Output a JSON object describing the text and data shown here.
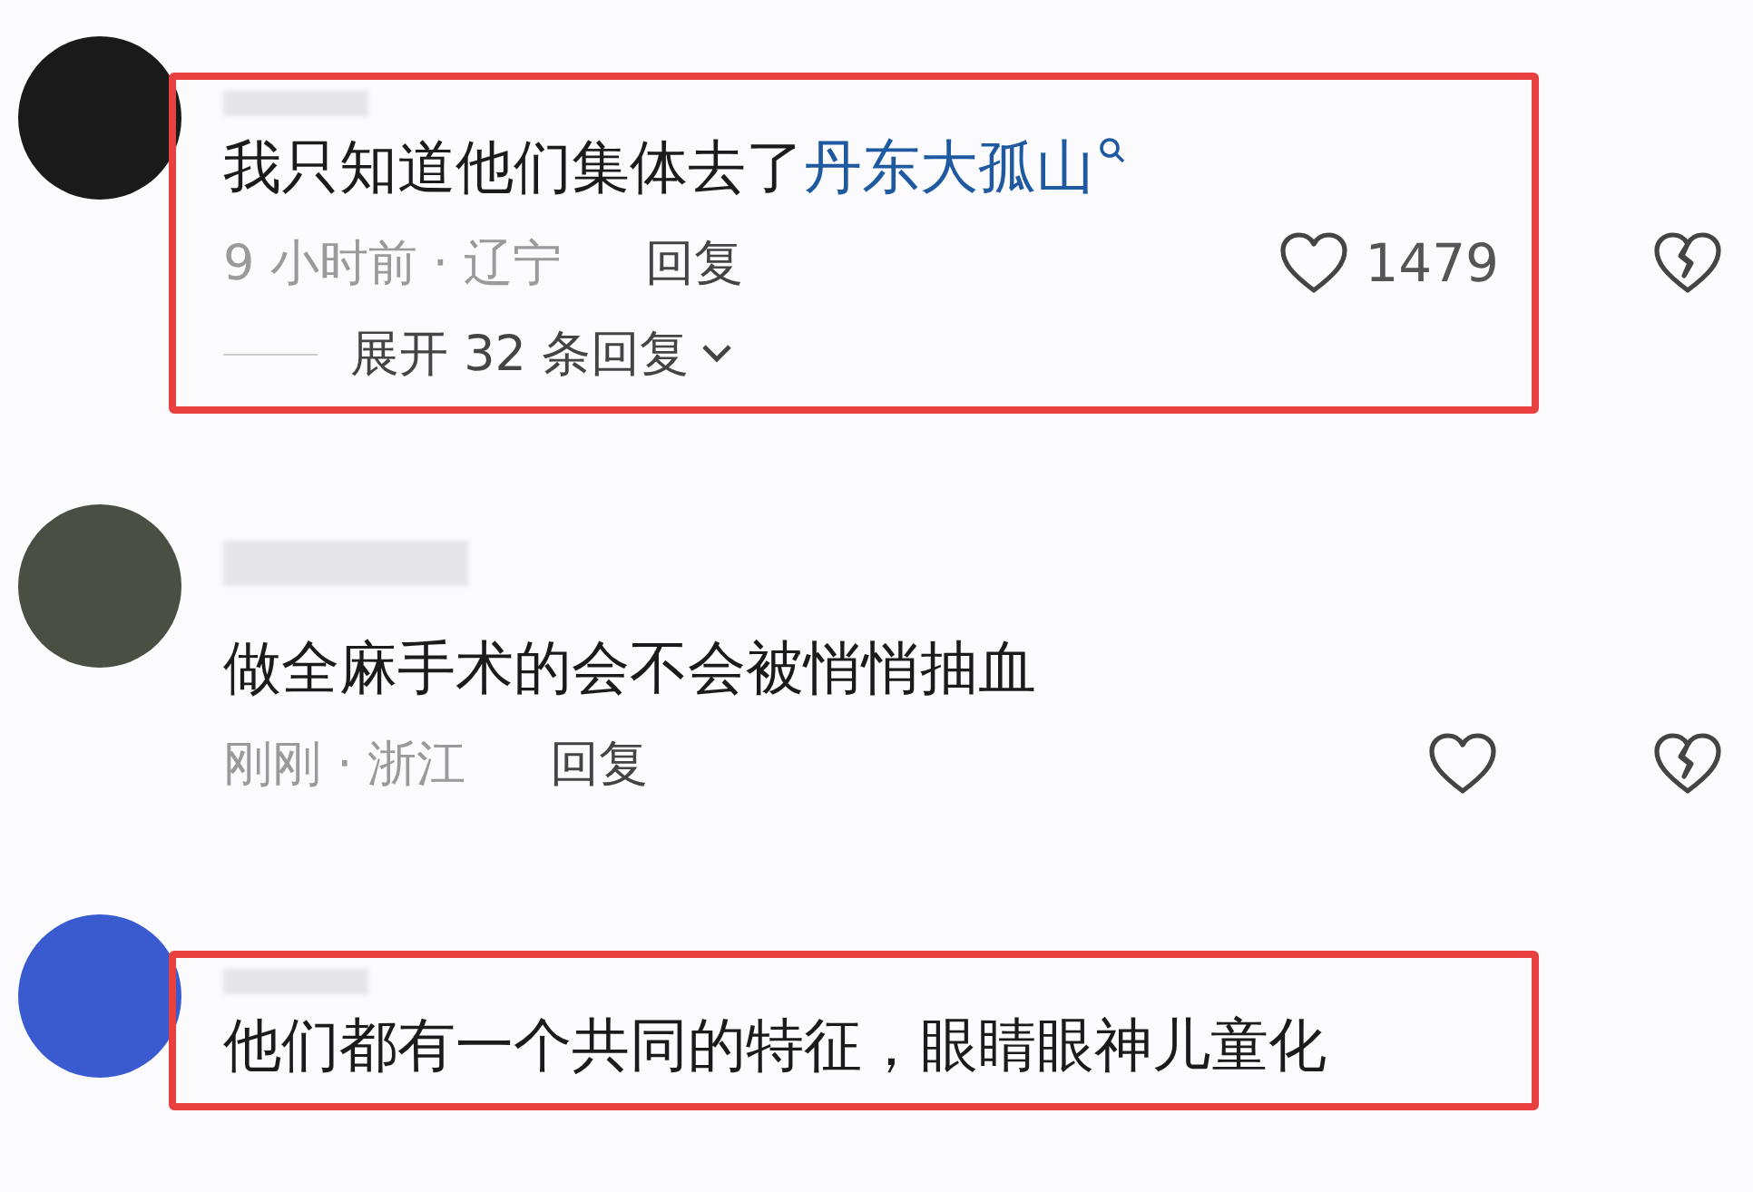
{
  "comments": [
    {
      "highlighted": true,
      "text": "我只知道他们集体去了",
      "link": "丹东大孤山",
      "time_location": "9 小时前 · 辽宁",
      "reply": "回复",
      "likes": "1479",
      "expand": "展开 32 条回复"
    },
    {
      "highlighted": false,
      "text": "做全麻手术的会不会被悄悄抽血",
      "time_location": "刚刚 · 浙江",
      "reply": "回复"
    },
    {
      "highlighted": true,
      "text": "他们都有一个共同的特征，眼睛眼神儿童化"
    }
  ]
}
